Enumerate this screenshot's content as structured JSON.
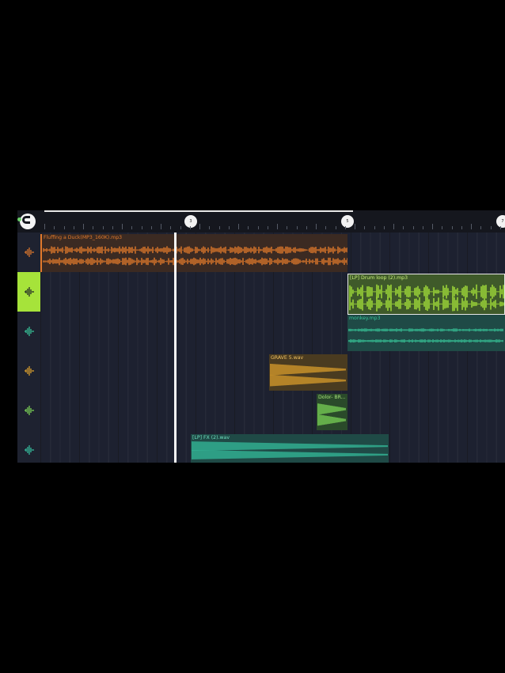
{
  "ruler": {
    "snap_icon": "magnet-icon",
    "markers": [
      "3",
      "5",
      "7"
    ]
  },
  "tracks": [
    {
      "id": "t1",
      "icon": "waveform-icon",
      "color": "#e27a2c",
      "active": false
    },
    {
      "id": "t2",
      "icon": "waveform-icon",
      "color": "#a6e33a",
      "active": true
    },
    {
      "id": "t3",
      "icon": "waveform-icon",
      "color": "#38c79a",
      "active": false
    },
    {
      "id": "t4",
      "icon": "waveform-icon",
      "color": "#e2a32c",
      "active": false
    },
    {
      "id": "t5",
      "icon": "waveform-icon",
      "color": "#7ed957",
      "active": false
    },
    {
      "id": "t6",
      "icon": "waveform-icon",
      "color": "#36c2a0",
      "active": false
    }
  ],
  "clips": [
    {
      "name": "Fluffing a Duck(MP3_160K).mp3",
      "track": 0,
      "color": "#e27a2c",
      "bg": "#3b2a22"
    },
    {
      "name": "[LP] Drum loop (2).mp3",
      "track": 1,
      "color": "#a6e33a",
      "bg": "#3f5a2a",
      "selected": true
    },
    {
      "name": "monkey.mp3",
      "track": 2,
      "color": "#38c79a",
      "bg": "#1f4a46"
    },
    {
      "name": "GRAVE 5.wav",
      "track": 3,
      "color": "#e2a32c",
      "bg": "#4a3b20"
    },
    {
      "name": "Dolor- BR...",
      "track": 4,
      "color": "#7ed957",
      "bg": "#2a4a2a"
    },
    {
      "name": "[LP] FX (2).wav",
      "track": 5,
      "color": "#36c2a0",
      "bg": "#1f4a46"
    }
  ]
}
